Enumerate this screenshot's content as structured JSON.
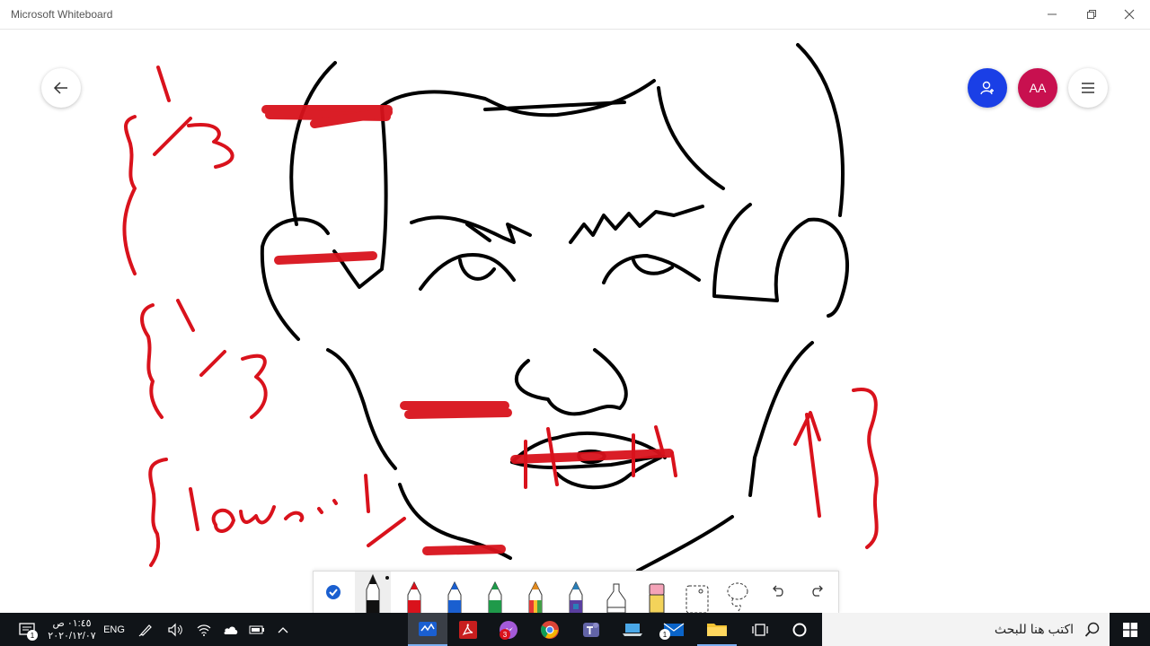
{
  "window": {
    "title": "Microsoft Whiteboard",
    "minimize_icon": "minimize-icon",
    "restore_icon": "restore-icon",
    "close_icon": "close-icon"
  },
  "header": {
    "back_icon": "arrow-left-icon",
    "invite_icon": "add-person-icon",
    "avatar_initials": "AA",
    "menu_icon": "hamburger-icon",
    "colors": {
      "invite": "#1a3fe6",
      "avatar": "#c8104f"
    }
  },
  "canvas": {
    "annotations": [
      "1/3",
      "1/3",
      "low",
      "1/3"
    ],
    "ink_colors": {
      "black": "#000000",
      "red": "#d9121c"
    }
  },
  "toolbar": {
    "tools": [
      {
        "name": "ink-to-shape-check",
        "icon": "checkmark-icon",
        "selected": false
      },
      {
        "name": "pen-black",
        "icon": "pen-icon",
        "color": "#111111",
        "selected": true
      },
      {
        "name": "pen-red",
        "icon": "pen-icon",
        "color": "#d9121c"
      },
      {
        "name": "pen-blue",
        "icon": "pen-icon",
        "color": "#1a5fd0"
      },
      {
        "name": "pen-green",
        "icon": "pen-icon",
        "color": "#1f9a4a"
      },
      {
        "name": "pen-rainbow",
        "icon": "pen-icon",
        "color": "#e28a1e"
      },
      {
        "name": "pen-galaxy",
        "icon": "pen-icon",
        "color": "#2a7fb8"
      },
      {
        "name": "highlighter",
        "icon": "highlighter-icon",
        "color": "#ffffff"
      },
      {
        "name": "eraser",
        "icon": "eraser-icon",
        "color": "#f4a3b8"
      },
      {
        "name": "ruler",
        "icon": "ruler-icon"
      },
      {
        "name": "lasso",
        "icon": "lasso-icon"
      },
      {
        "name": "undo",
        "icon": "undo-icon"
      },
      {
        "name": "redo",
        "icon": "redo-icon"
      }
    ]
  },
  "taskbar": {
    "clock_time": "٠١:٤٥ ص",
    "clock_date": "٢٠٢٠/١٢/٠٧",
    "language": "ENG",
    "search_placeholder": "اكتب هنا للبحث",
    "notification_count": "1",
    "app_badges": {
      "messenger": "3",
      "mail": "1"
    },
    "icons": [
      "notification-icon",
      "pen-workspace-icon",
      "volume-icon",
      "wifi-icon",
      "onedrive-icon",
      "battery-icon",
      "chevron-up-icon",
      "whiteboard-app-icon",
      "acrobat-icon",
      "messenger-icon",
      "chrome-icon",
      "teams-icon",
      "laptop-icon",
      "mail-icon",
      "file-explorer-icon",
      "task-view-icon",
      "cortana-icon",
      "search-icon",
      "windows-start-icon"
    ]
  }
}
